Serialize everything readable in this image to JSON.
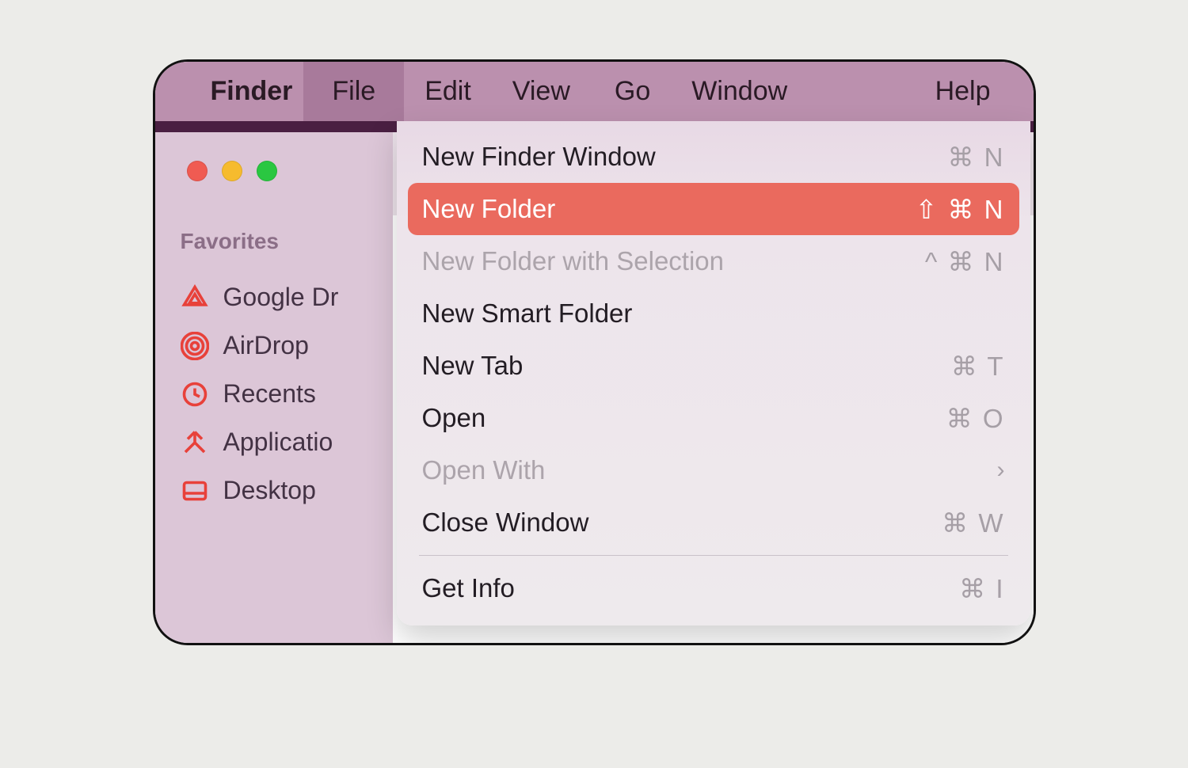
{
  "menubar": {
    "app": "Finder",
    "items": [
      "File",
      "Edit",
      "View",
      "Go",
      "Window",
      "Help"
    ],
    "active": "File"
  },
  "sidebar": {
    "heading": "Favorites",
    "items": [
      {
        "label": "Google Dr",
        "icon": "google-drive"
      },
      {
        "label": "AirDrop",
        "icon": "airdrop"
      },
      {
        "label": "Recents",
        "icon": "recents"
      },
      {
        "label": "Applicatio",
        "icon": "applications"
      },
      {
        "label": "Desktop",
        "icon": "desktop"
      }
    ]
  },
  "dropdown": {
    "items": [
      {
        "label": "New Finder Window",
        "shortcut": "⌘ N",
        "disabled": false,
        "highlight": false
      },
      {
        "label": "New Folder",
        "shortcut": "⇧ ⌘ N",
        "disabled": false,
        "highlight": true
      },
      {
        "label": "New Folder with Selection",
        "shortcut": "^ ⌘ N",
        "disabled": true,
        "highlight": false
      },
      {
        "label": "New Smart Folder",
        "shortcut": "",
        "disabled": false,
        "highlight": false
      },
      {
        "label": "New Tab",
        "shortcut": "⌘ T",
        "disabled": false,
        "highlight": false
      },
      {
        "label": "Open",
        "shortcut": "⌘ O",
        "disabled": false,
        "highlight": false
      },
      {
        "label": "Open With",
        "shortcut": "",
        "submenu": true,
        "disabled": true,
        "highlight": false
      },
      {
        "label": "Close Window",
        "shortcut": "⌘ W",
        "disabled": false,
        "highlight": false
      },
      {
        "separator": true
      },
      {
        "label": "Get Info",
        "shortcut": "⌘ I",
        "disabled": false,
        "highlight": false
      }
    ]
  }
}
